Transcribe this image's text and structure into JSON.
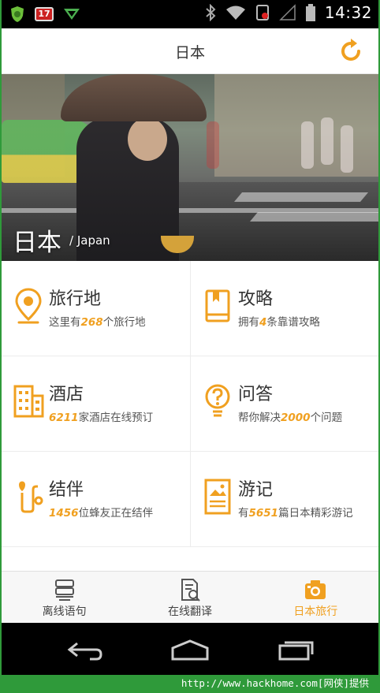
{
  "status_bar": {
    "time": "14:32",
    "calendar_day": "17"
  },
  "header": {
    "title": "日本"
  },
  "hero": {
    "title": "日本",
    "subtitle": "/ Japan"
  },
  "grid": [
    {
      "heading": "旅行地",
      "desc_pre": "这里有",
      "num": "268",
      "desc_post": "个旅行地",
      "icon": "location-pin-icon"
    },
    {
      "heading": "攻略",
      "desc_pre": "拥有",
      "num": "4",
      "desc_post": "条靠谱攻略",
      "icon": "guidebook-icon"
    },
    {
      "heading": "酒店",
      "desc_pre": "",
      "num": "6211",
      "desc_post": "家酒店在线预订",
      "icon": "hotel-building-icon"
    },
    {
      "heading": "问答",
      "desc_pre": "帮你解决",
      "num": "2000",
      "desc_post": "个问题",
      "icon": "question-bulb-icon"
    },
    {
      "heading": "结伴",
      "desc_pre": "",
      "num": "1456",
      "desc_post": "位蜂友正在结伴",
      "icon": "route-icon"
    },
    {
      "heading": "游记",
      "desc_pre": "有",
      "num": "5651",
      "desc_post": "篇日本精彩游记",
      "icon": "travelogue-icon"
    }
  ],
  "tabs": [
    {
      "label": "离线语句",
      "icon": "phrasebook-icon",
      "active": false
    },
    {
      "label": "在线翻译",
      "icon": "translate-doc-icon",
      "active": false
    },
    {
      "label": "日本旅行",
      "icon": "camera-icon",
      "active": true
    }
  ],
  "watermark": "http://www.hackhome.com[网侠]提供",
  "colors": {
    "accent": "#f0a020",
    "frame": "#2f9a3a"
  }
}
